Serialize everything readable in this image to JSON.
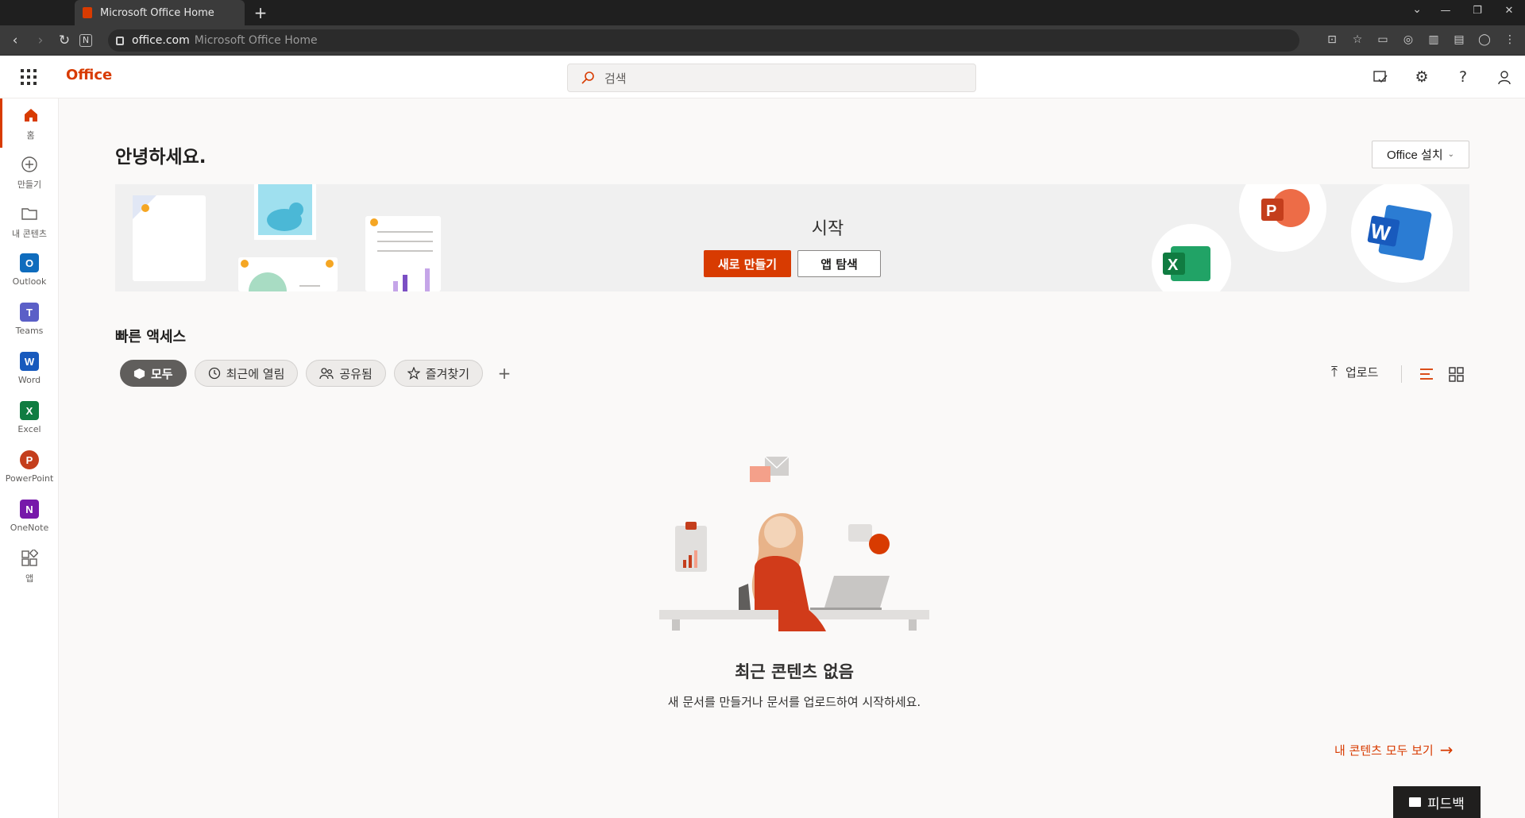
{
  "browser": {
    "tab_title": "Microsoft Office Home",
    "new_tab_label": "+",
    "url_domain": "office.com",
    "url_title": "Microsoft Office Home"
  },
  "header": {
    "brand": "Office",
    "search_placeholder": "검색"
  },
  "rail": {
    "items": [
      {
        "label": "홈",
        "icon": "home-icon"
      },
      {
        "label": "만들기",
        "icon": "create-icon"
      },
      {
        "label": "내 콘텐츠",
        "icon": "folder-icon"
      },
      {
        "label": "Outlook",
        "icon": "outlook-icon"
      },
      {
        "label": "Teams",
        "icon": "teams-icon"
      },
      {
        "label": "Word",
        "icon": "word-icon"
      },
      {
        "label": "Excel",
        "icon": "excel-icon"
      },
      {
        "label": "PowerPoint",
        "icon": "powerpoint-icon"
      },
      {
        "label": "OneNote",
        "icon": "onenote-icon"
      },
      {
        "label": "앱",
        "icon": "apps-icon"
      }
    ]
  },
  "main": {
    "greeting": "안녕하세요.",
    "install_label": "Office 설치",
    "banner": {
      "title": "시작",
      "new_label": "새로 만들기",
      "explore_label": "앱 탐색"
    },
    "quick_access": {
      "title": "빠른 액세스",
      "filters": [
        "모두",
        "최근에 열림",
        "공유됨",
        "즐겨찾기"
      ],
      "add_label": "+",
      "upload_label": "업로드"
    },
    "empty": {
      "title": "최근 콘텐츠 없음",
      "subtitle": "새 문서를 만들거나 문서를 업로드하여 시작하세요."
    },
    "see_all_label": "내 콘텐츠 모두 보기",
    "feedback_label": "피드백"
  },
  "colors": {
    "accent": "#d83b01",
    "word": "#185abd",
    "excel": "#107c41",
    "powerpoint": "#c43e1c",
    "onenote": "#7719aa",
    "outlook": "#0f6cbd",
    "teams": "#5b5fc7"
  }
}
